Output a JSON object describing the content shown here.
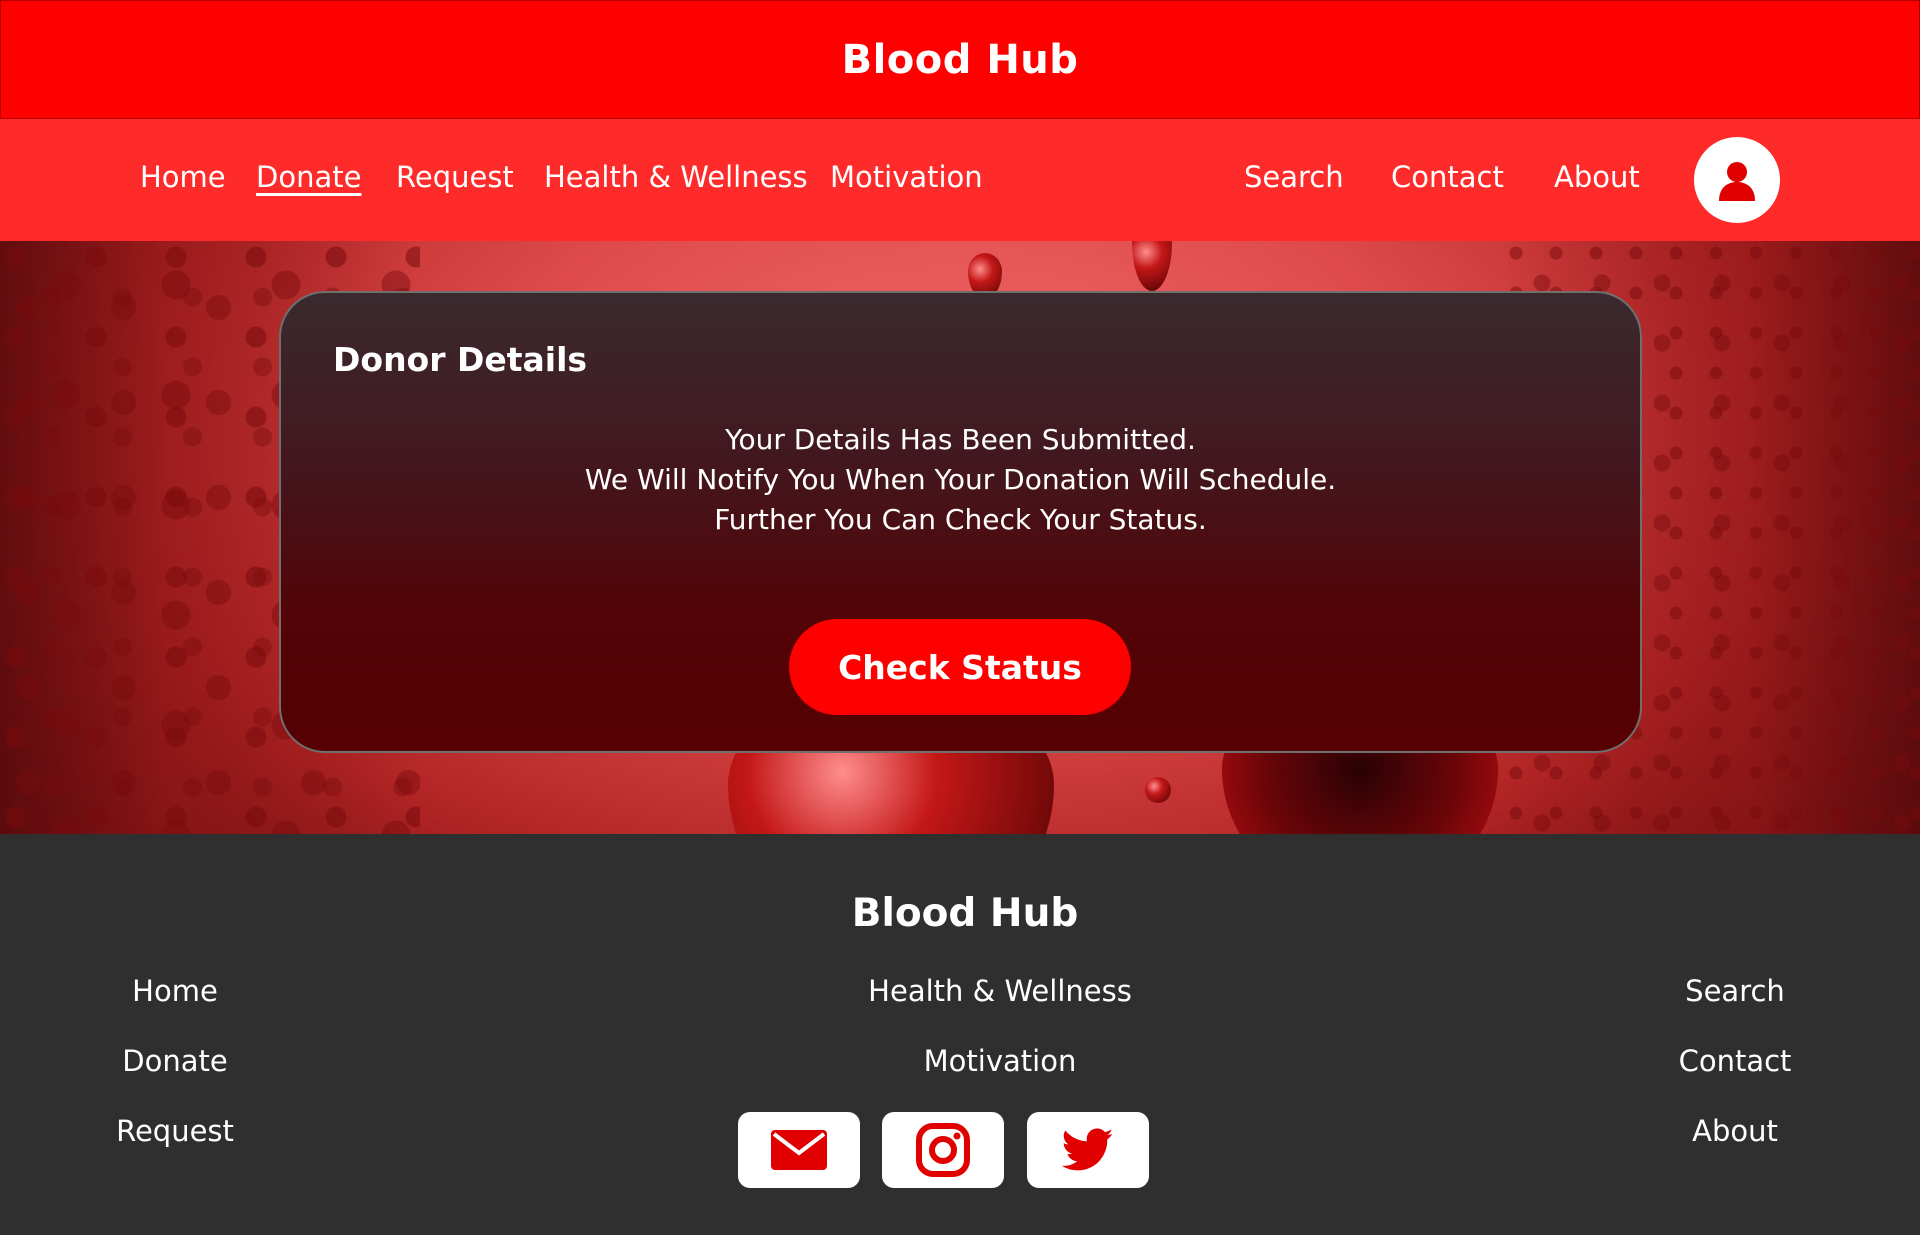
{
  "header": {
    "title": "Blood Hub"
  },
  "nav": {
    "left": [
      {
        "label": "Home"
      },
      {
        "label": "Donate",
        "active": true
      },
      {
        "label": "Request"
      },
      {
        "label": "Health & Wellness"
      },
      {
        "label": "Motivation"
      }
    ],
    "right": [
      {
        "label": "Search"
      },
      {
        "label": "Contact"
      },
      {
        "label": "About"
      }
    ],
    "profile_icon": "user-icon"
  },
  "card": {
    "title": "Donor Details",
    "message": [
      "Your Details Has Been Submitted.",
      "We Will Notify You When Your Donation Will Schedule.",
      "Further You Can Check Your Status."
    ],
    "button": "Check Status"
  },
  "footer": {
    "title": "Blood Hub",
    "left_links": [
      "Home",
      "Donate",
      "Request"
    ],
    "center_links": [
      "Health & Wellness",
      "Motivation"
    ],
    "right_links": [
      "Search",
      "Contact",
      "About"
    ],
    "social": [
      "mail-icon",
      "instagram-icon",
      "twitter-icon"
    ]
  },
  "colors": {
    "brand_red": "#ff0000",
    "nav_red": "#ff2a2a",
    "footer_bg": "#2f2f30",
    "card_bottom": "#560003"
  }
}
